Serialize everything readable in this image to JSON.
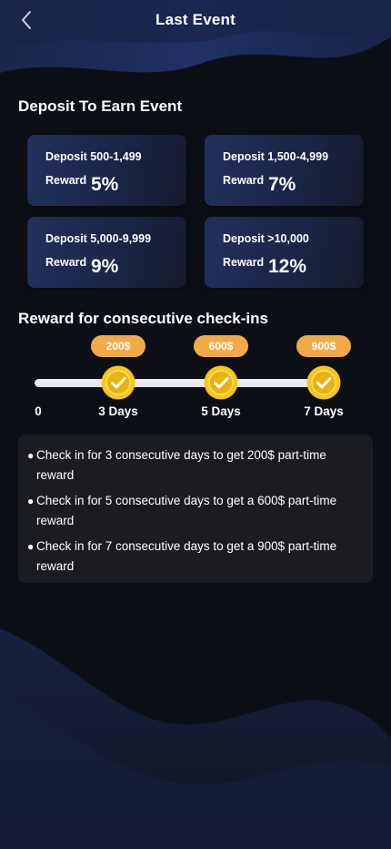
{
  "header": {
    "title": "Last Event"
  },
  "deposit_section": {
    "title": "Deposit To Earn Event",
    "cards": [
      {
        "deposit": "Deposit 500-1,499",
        "reward_label": "Reward",
        "reward": "5%"
      },
      {
        "deposit": "Deposit 1,500-4,999",
        "reward_label": "Reward",
        "reward": "7%"
      },
      {
        "deposit": "Deposit 5,000-9,999",
        "reward_label": "Reward",
        "reward": "9%"
      },
      {
        "deposit": "Deposit >10,000",
        "reward_label": "Reward",
        "reward": "12%"
      }
    ]
  },
  "checkin_section": {
    "title": "Reward for consecutive check-ins",
    "start_label": "0",
    "milestones": [
      {
        "amount": "200$",
        "label": "3 Days"
      },
      {
        "amount": "600$",
        "label": "5 Days"
      },
      {
        "amount": "900$",
        "label": "7 Days"
      }
    ],
    "rules": [
      "Check in for 3 consecutive days to get 200$ part-time reward",
      "Check in for 5 consecutive days to get a 600$ part-time reward",
      "Check in for 7 consecutive days to get a 900$ part-time reward"
    ],
    "bullet": "●"
  },
  "colors": {
    "background": "#0d0f17",
    "card": "#22305e",
    "pill": "#f2aa47",
    "coin": "#f8c51a",
    "track": "#e9e9ee",
    "rules_box": "#1b1c22"
  }
}
